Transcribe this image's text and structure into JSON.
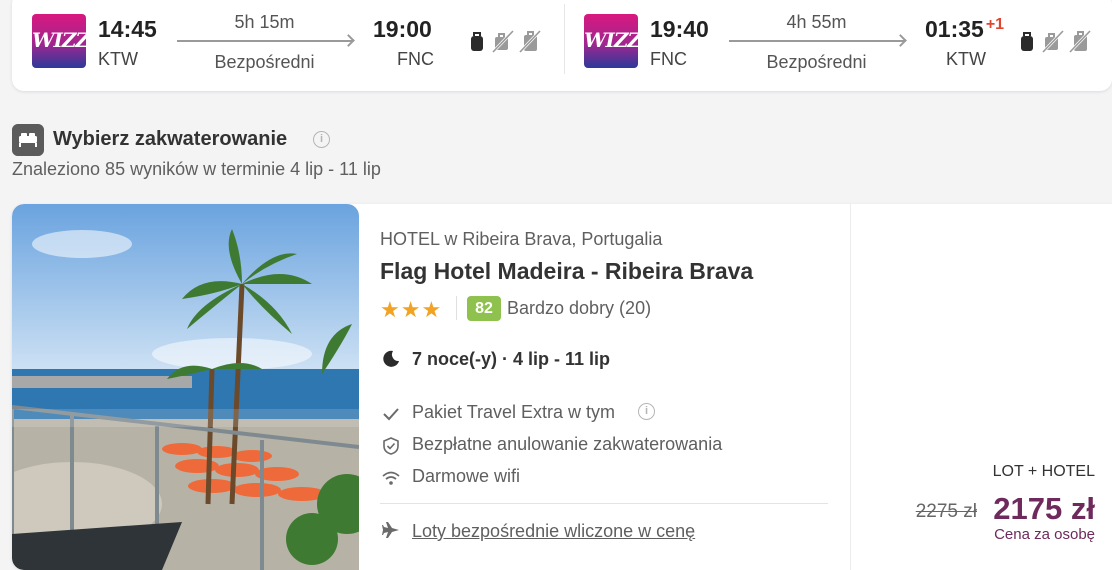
{
  "flights": {
    "outbound": {
      "airline_logo": "WIZZ",
      "depart_time": "14:45",
      "depart_code": "KTW",
      "duration": "5h 15m",
      "stops": "Bezpośredni",
      "arrive_time": "19:00",
      "arrive_code": "FNC",
      "day_offset": ""
    },
    "return": {
      "airline_logo": "WIZZ",
      "depart_time": "19:40",
      "depart_code": "FNC",
      "duration": "4h 55m",
      "stops": "Bezpośredni",
      "arrive_time": "01:35",
      "arrive_code": "KTW",
      "day_offset": "+1"
    },
    "baggage_icons": [
      "backpack-icon",
      "suitcase-crossed-icon",
      "checked-bag-crossed-icon"
    ]
  },
  "section": {
    "icon": "bed-icon",
    "title": "Wybierz zakwaterowanie",
    "info_icon": "i",
    "results": "Znaleziono 85 wyników w terminie 4 lip - 11 lip"
  },
  "hotel": {
    "type_line": "HOTEL w Ribeira Brava, Portugalia",
    "name": "Flag Hotel Madeira - Ribeira Brava",
    "stars": "★★★",
    "star_count": 3,
    "score": "82",
    "rating": "Bardzo dobry (20)",
    "nights": "7 noce(-y) · 4 lip - 11 lip",
    "features": [
      {
        "icon": "check-icon",
        "label": "Pakiet Travel Extra w tym"
      },
      {
        "icon": "shield-check-icon",
        "label": "Bezpłatne anulowanie zakwaterowania"
      },
      {
        "icon": "wifi-icon",
        "label": "Darmowe wifi"
      }
    ],
    "feature_info": "i",
    "flights_link": "Loty bezpośrednie wliczone w cenę",
    "package_label": "LOT + HOTEL",
    "old_price": "2275 zł",
    "price": "2175 zł",
    "price_note": "Cena za osobę"
  },
  "colors": {
    "accent_price": "#6e2a5c",
    "star": "#f2a323",
    "score_bg": "#8fc14e",
    "day_offset": "#e0452f"
  }
}
